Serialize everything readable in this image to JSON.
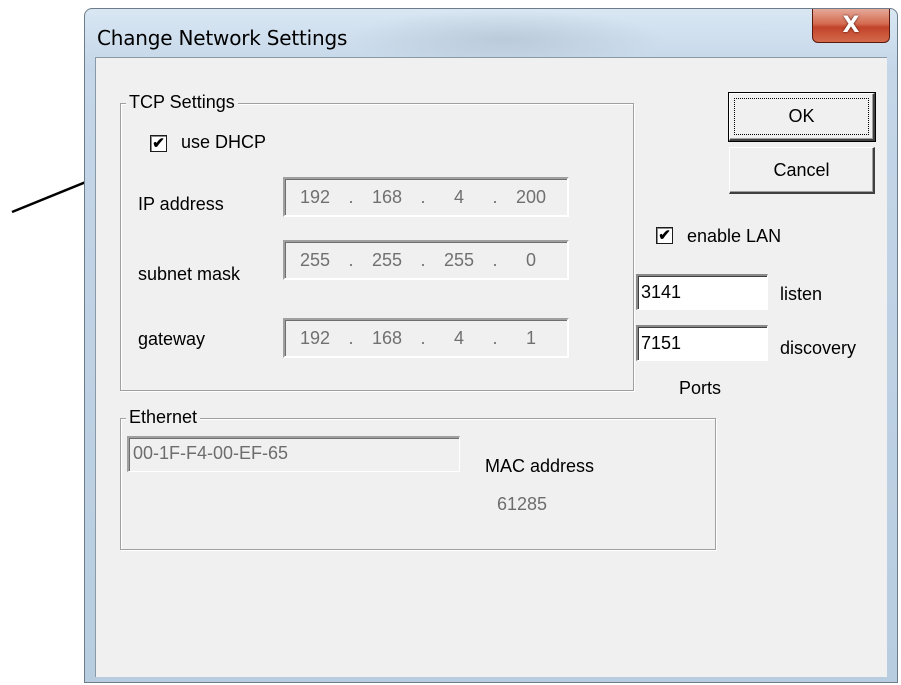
{
  "window": {
    "title": "Change Network Settings",
    "close_symbol": "X"
  },
  "tcp": {
    "legend": "TCP Settings",
    "dhcp_label": "use DHCP",
    "dhcp_checked": true,
    "ip_label": "IP address",
    "ip": [
      "192",
      "168",
      "4",
      "200"
    ],
    "mask_label": "subnet mask",
    "mask": [
      "255",
      "255",
      "255",
      "0"
    ],
    "gateway_label": "gateway",
    "gateway": [
      "192",
      "168",
      "4",
      "1"
    ]
  },
  "buttons": {
    "ok": "OK",
    "cancel": "Cancel"
  },
  "lan": {
    "enable_label": "enable LAN",
    "enable_checked": true,
    "listen_value": "3141",
    "listen_label": "listen",
    "discovery_value": "7151",
    "discovery_label": "discovery",
    "ports_label": "Ports"
  },
  "ethernet": {
    "legend": "Ethernet",
    "mac_value": "00-1F-F4-00-EF-65",
    "mac_label": "MAC address",
    "number": "61285"
  },
  "icons": {
    "check": "✔",
    "checkbox_icon": "checkbox-icon",
    "close_icon": "close-icon",
    "arrow_icon": "pointer-arrow-icon"
  },
  "colors": {
    "close_button": "#c2432a",
    "dialog_bg": "#f0f0f0",
    "title_bar": "#c4d6e8"
  }
}
